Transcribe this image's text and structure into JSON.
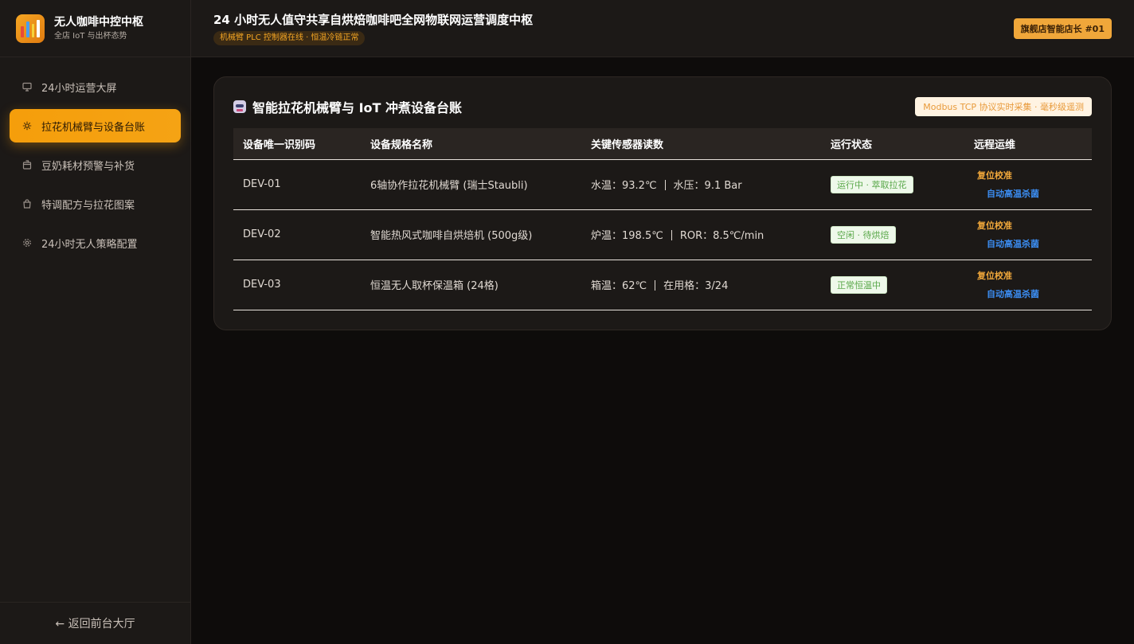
{
  "brand": {
    "title": "无人咖啡中控中枢",
    "subtitle": "全店 IoT 与出杯态势",
    "logo_colors": [
      "#e84a3a",
      "#4a9ef0",
      "#f5d23a",
      "#ffffff"
    ]
  },
  "sidebar": {
    "items": [
      {
        "label": "24小时运营大屏",
        "icon": "monitor-icon",
        "active": false
      },
      {
        "label": "拉花机械臂与设备台账",
        "icon": "gear-icon",
        "active": true
      },
      {
        "label": "豆奶耗材预警与补货",
        "icon": "box-icon",
        "active": false
      },
      {
        "label": "特调配方与拉花图案",
        "icon": "bag-icon",
        "active": false
      },
      {
        "label": "24小时无人策略配置",
        "icon": "settings-icon",
        "active": false
      }
    ],
    "footer": "← 返回前台大厅"
  },
  "header": {
    "title": "24 小时无人值守共享自烘焙咖啡吧全网物联网运营调度中枢",
    "status": "机械臂 PLC 控制器在线 · 恒温冷链正常",
    "store_badge": "旗舰店智能店长 #01"
  },
  "card": {
    "title": "智能拉花机械臂与 IoT 冲煮设备台账",
    "protocol_badge": "Modbus TCP 协议实时采集 · 毫秒级遥测",
    "columns": [
      "设备唯一识别码",
      "设备规格名称",
      "关键传感器读数",
      "运行状态",
      "远程运维"
    ],
    "rows": [
      {
        "id": "DEV-01",
        "name": "6轴协作拉花机械臂 (瑞士Staubli)",
        "reading_a": "水温：93.2℃",
        "reading_b": "水压：9.1 Bar",
        "status": "运行中 · 萃取拉花",
        "op_reset": "复位校准",
        "op_steril": "自动高温杀菌"
      },
      {
        "id": "DEV-02",
        "name": "智能热风式咖啡自烘焙机 (500g级)",
        "reading_a": "炉温：198.5℃",
        "reading_b": "ROR：8.5℃/min",
        "status": "空闲 · 待烘焙",
        "op_reset": "复位校准",
        "op_steril": "自动高温杀菌"
      },
      {
        "id": "DEV-03",
        "name": "恒温无人取杯保温箱 (24格)",
        "reading_a": "箱温：62℃",
        "reading_b": "在用格：3/24",
        "status": "正常恒温中",
        "op_reset": "复位校准",
        "op_steril": "自动高温杀菌"
      }
    ]
  },
  "colors": {
    "accent": "#f59e0b",
    "status_green": "#5aa84a",
    "link_blue": "#3b8cf0",
    "link_orange": "#f0a73a"
  }
}
